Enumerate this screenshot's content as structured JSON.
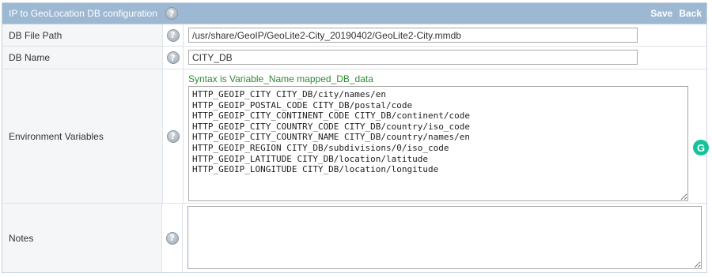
{
  "header": {
    "title": "IP to GeoLocation DB configuration",
    "help_symbol": "?",
    "save_label": "Save",
    "back_label": "Back"
  },
  "rows": {
    "db_file_path": {
      "label": "DB File Path",
      "value": "/usr/share/GeoIP/GeoLite2-City_20190402/GeoLite2-City.mmdb"
    },
    "db_name": {
      "label": "DB Name",
      "value": "CITY_DB"
    },
    "env_vars": {
      "label": "Environment Variables",
      "hint": "Syntax is Variable_Name mapped_DB_data",
      "value": "HTTP_GEOIP_CITY CITY_DB/city/names/en\nHTTP_GEOIP_POSTAL_CODE CITY_DB/postal/code\nHTTP_GEOIP_CITY_CONTINENT_CODE CITY_DB/continent/code\nHTTP_GEOIP_CITY_COUNTRY_CODE CITY_DB/country/iso_code\nHTTP_GEOIP_CITY_COUNTRY_NAME CITY_DB/country/names/en\nHTTP_GEOIP_REGION CITY_DB/subdivisions/0/iso_code\nHTTP_GEOIP_LATITUDE CITY_DB/location/latitude\nHTTP_GEOIP_LONGITUDE CITY_DB/location/longitude"
    },
    "notes": {
      "label": "Notes",
      "value": ""
    }
  },
  "grammarly_symbol": "G",
  "colors": {
    "header_bg": "#9db8d2",
    "hint_text": "#2e8b2e",
    "grammarly": "#15c39a"
  }
}
